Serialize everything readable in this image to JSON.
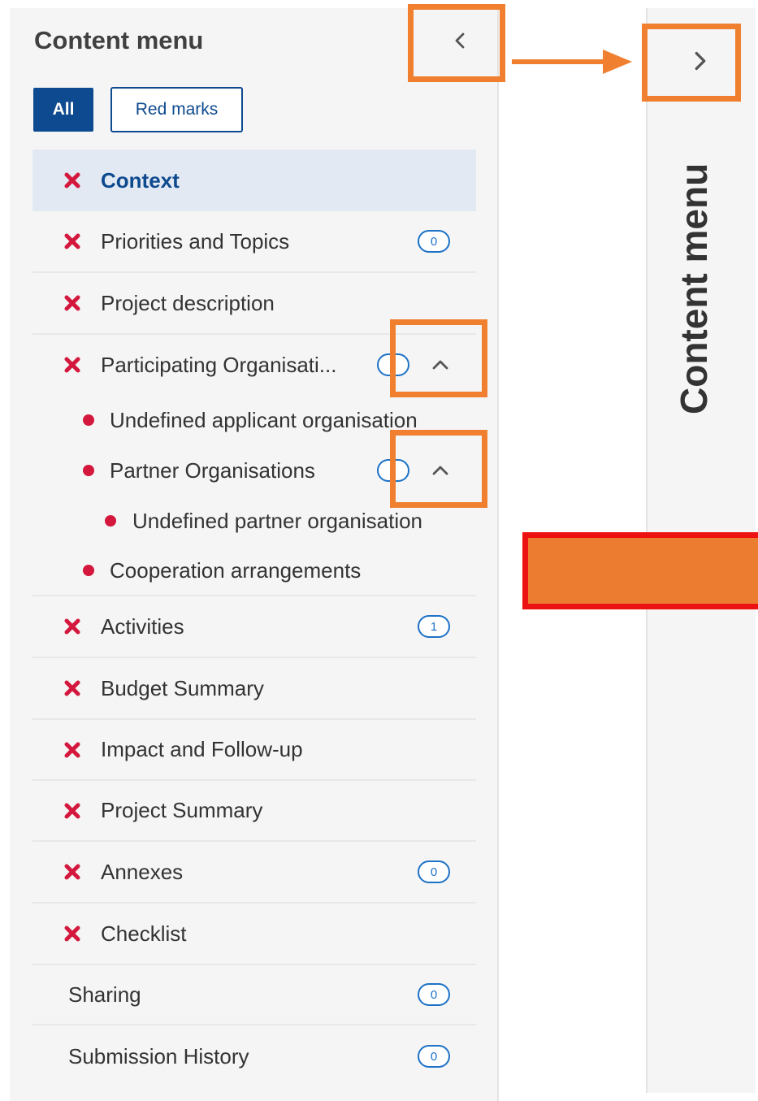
{
  "panel": {
    "title": "Content menu",
    "filters": {
      "all": "All",
      "red_marks": "Red marks"
    }
  },
  "items": [
    {
      "label": "Context",
      "red_x": true,
      "active": true
    },
    {
      "label": "Priorities and Topics",
      "red_x": true,
      "badge": "0"
    },
    {
      "label": "Project description",
      "red_x": true
    },
    {
      "label": "Participating Organisati...",
      "red_x": true,
      "badge": "",
      "expanded": true
    },
    {
      "label": "Undefined applicant organisation",
      "red_dot": true,
      "level": 1
    },
    {
      "label": "Partner Organisations",
      "red_dot": true,
      "level": 1,
      "badge": "",
      "expanded": true
    },
    {
      "label": "Undefined partner organisation",
      "red_dot": true,
      "level": 2
    },
    {
      "label": "Cooperation arrangements",
      "red_dot": true,
      "level": 1
    },
    {
      "label": "Activities",
      "red_x": true,
      "badge": "1"
    },
    {
      "label": "Budget Summary",
      "red_x": true
    },
    {
      "label": "Impact and Follow-up",
      "red_x": true
    },
    {
      "label": "Project Summary",
      "red_x": true
    },
    {
      "label": "Annexes",
      "red_x": true,
      "badge": "0"
    },
    {
      "label": "Checklist",
      "red_x": true
    },
    {
      "label": "Sharing",
      "badge": "0"
    },
    {
      "label": "Submission History",
      "badge": "0"
    }
  ],
  "collapsed_panel": {
    "title": "Content menu"
  },
  "colors": {
    "accent": "#0e4a8f",
    "error": "#d4183d",
    "badge": "#1d72c6",
    "annotation": "#f07f2f",
    "annotation_fill": "#ec7c30",
    "annotation_border": "#ee1111"
  },
  "icons": [
    "chevron-left-icon",
    "chevron-right-icon",
    "chevron-up-icon",
    "close-icon",
    "arrow-right-icon"
  ]
}
